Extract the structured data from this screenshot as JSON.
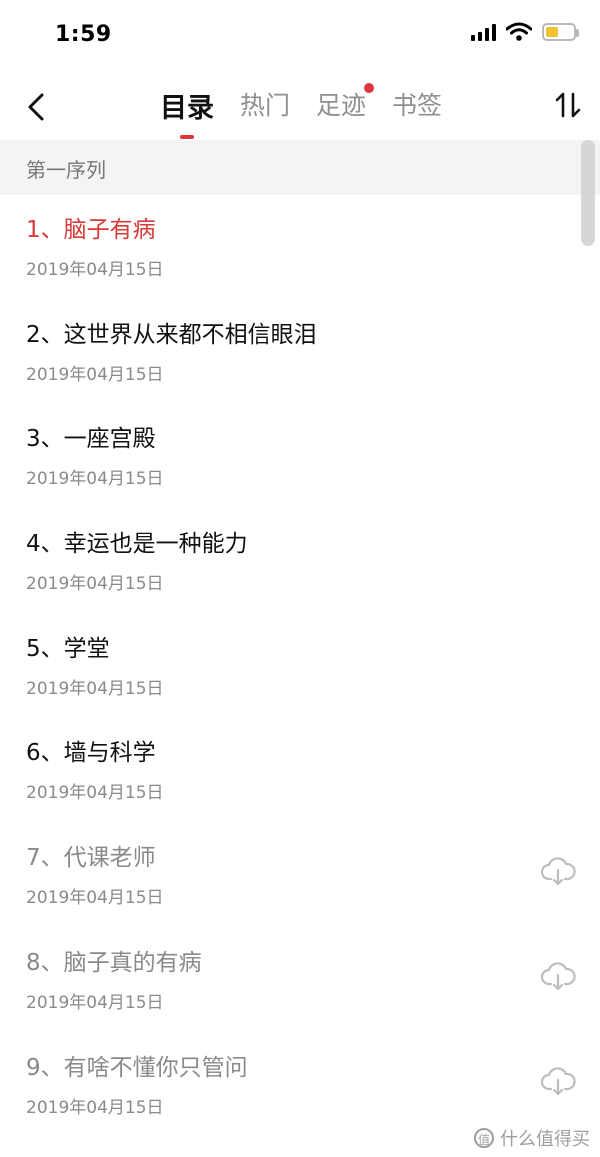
{
  "status_bar": {
    "time": "1:59",
    "icons": [
      "signal-icon",
      "wifi-icon",
      "battery-icon"
    ],
    "battery_color": "#f1c232"
  },
  "nav": {
    "back_icon": "chevron-left-icon",
    "tabs": [
      {
        "label": "目录",
        "active": true
      },
      {
        "label": "热门",
        "active": false
      },
      {
        "label": "足迹",
        "active": false,
        "badge_dot": true
      },
      {
        "label": "书签",
        "active": false
      }
    ],
    "sort_icon": "sort-icon",
    "accent_color": "#e0353f"
  },
  "section": {
    "title": "第一序列"
  },
  "chapters": [
    {
      "title": "1、脑子有病",
      "date": "2019年04月15日",
      "state": "current"
    },
    {
      "title": "2、这世界从来都不相信眼泪",
      "date": "2019年04月15日",
      "state": "normal"
    },
    {
      "title": "3、一座宫殿",
      "date": "2019年04月15日",
      "state": "normal"
    },
    {
      "title": "4、幸运也是一种能力",
      "date": "2019年04月15日",
      "state": "normal"
    },
    {
      "title": "5、学堂",
      "date": "2019年04月15日",
      "state": "normal"
    },
    {
      "title": "6、墙与科学",
      "date": "2019年04月15日",
      "state": "normal"
    },
    {
      "title": "7、代课老师",
      "date": "2019年04月15日",
      "state": "locked",
      "icon": "cloud-download-icon"
    },
    {
      "title": "8、脑子真的有病",
      "date": "2019年04月15日",
      "state": "locked",
      "icon": "cloud-download-icon"
    },
    {
      "title": "9、有啥不懂你只管问",
      "date": "2019年04月15日",
      "state": "locked",
      "icon": "cloud-download-icon"
    }
  ],
  "watermark": {
    "logo": "值",
    "text": "什么值得买"
  }
}
